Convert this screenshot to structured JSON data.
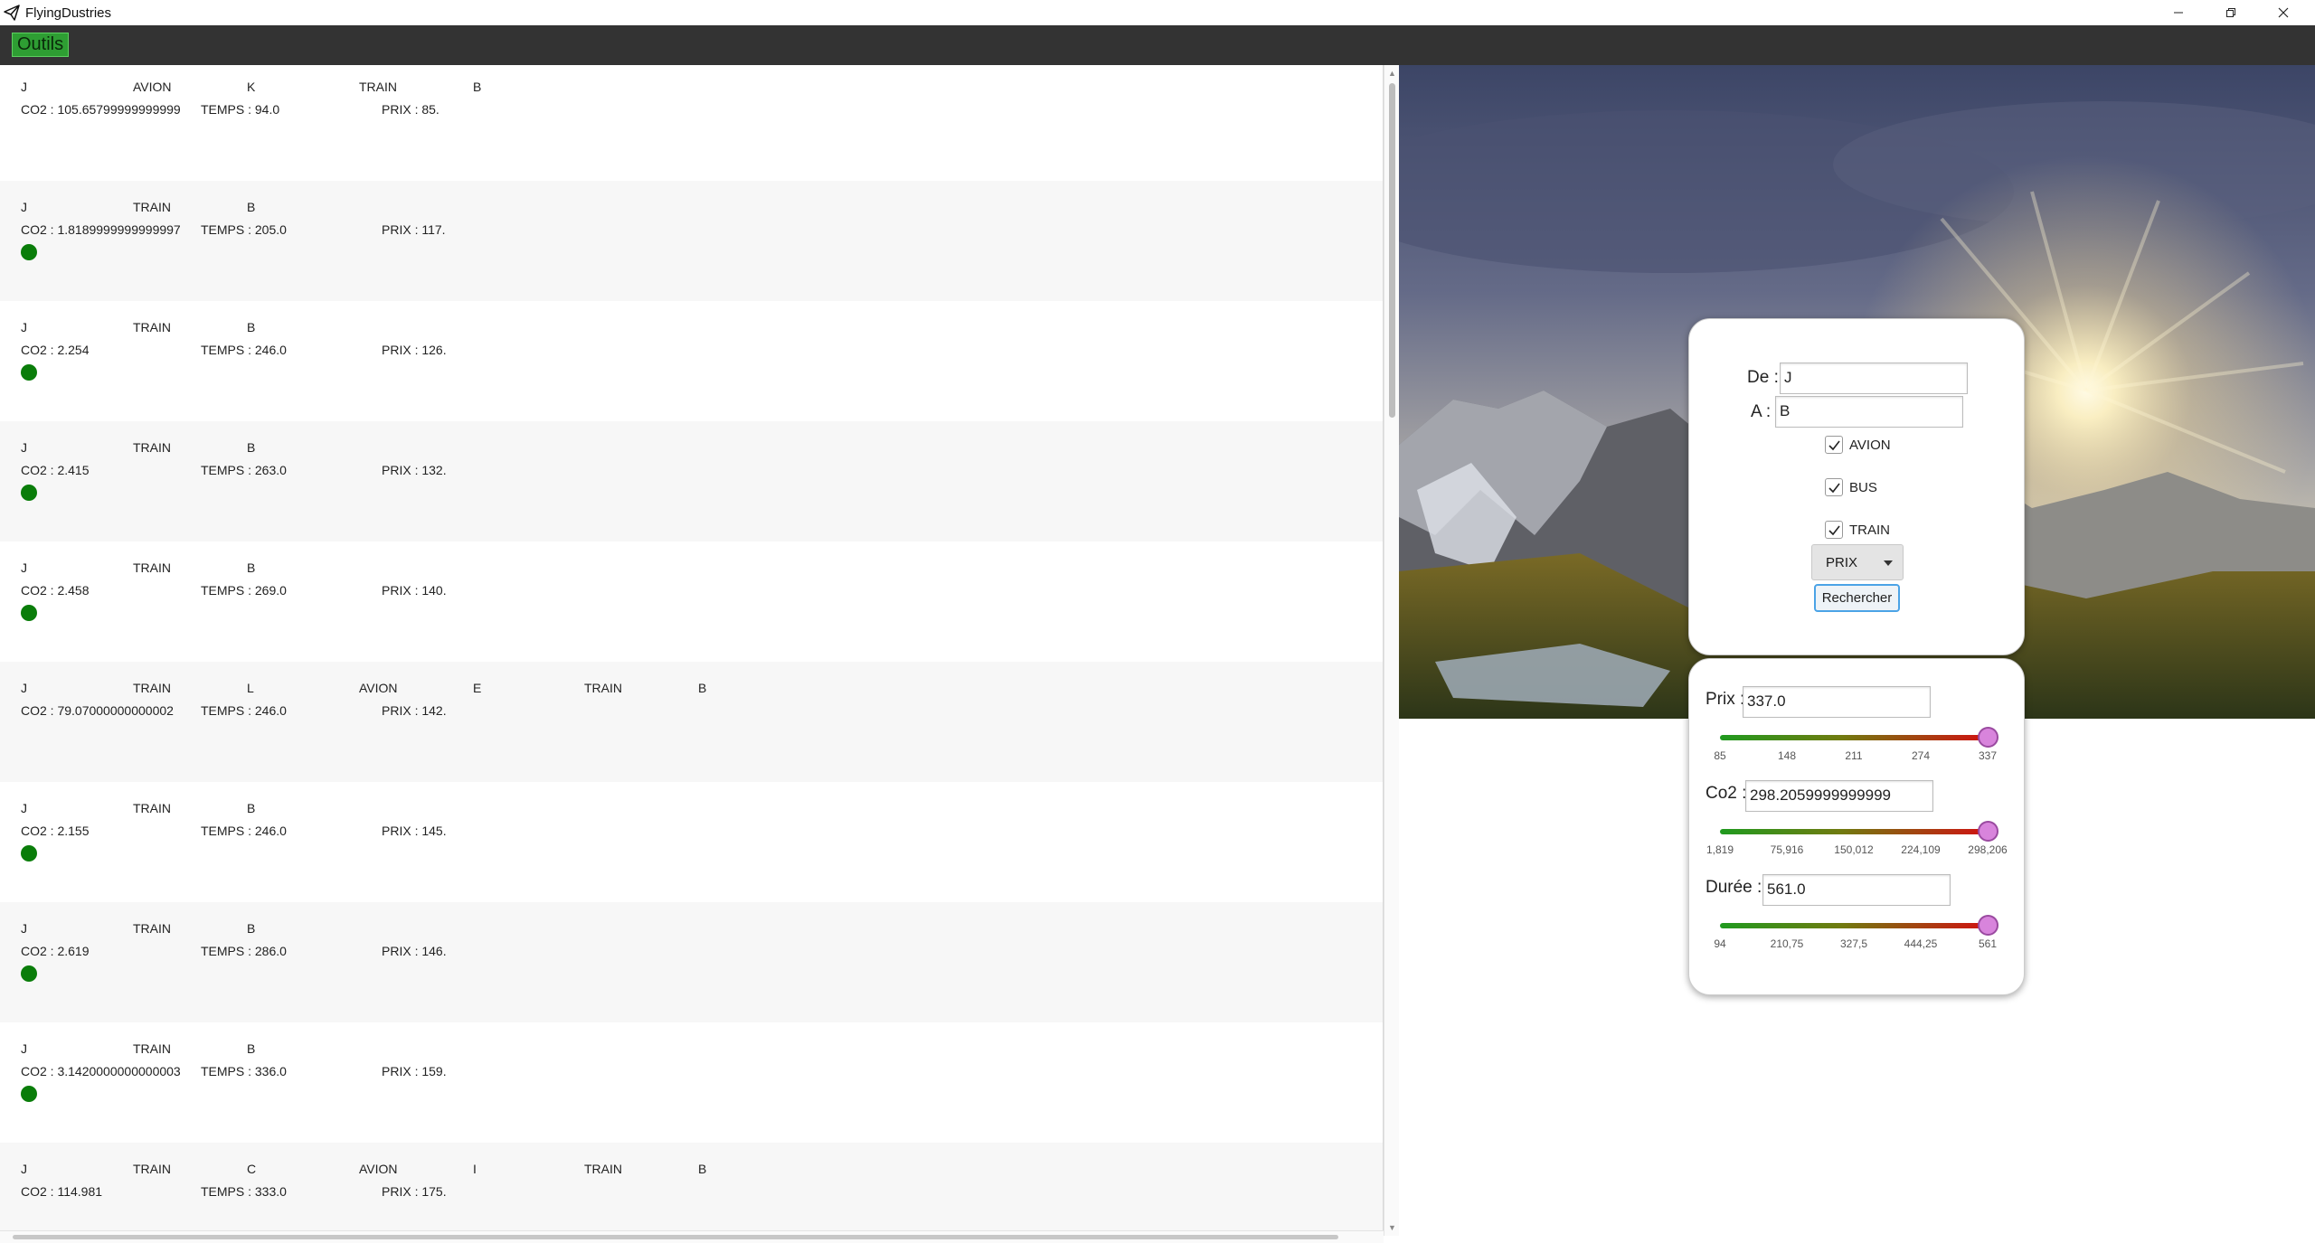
{
  "window": {
    "title": "FlyingDustries"
  },
  "menu": {
    "outils_label": "Outils"
  },
  "results": [
    {
      "route": [
        "J",
        "AVION",
        "K",
        "TRAIN",
        "B"
      ],
      "co2": "CO2 : 105.65799999999999",
      "temps": "TEMPS : 94.0",
      "prix": "PRIX : 85.",
      "green": false
    },
    {
      "route": [
        "J",
        "TRAIN",
        "B"
      ],
      "co2": "CO2 : 1.8189999999999997",
      "temps": "TEMPS : 205.0",
      "prix": "PRIX : 117.",
      "green": true
    },
    {
      "route": [
        "J",
        "TRAIN",
        "B"
      ],
      "co2": "CO2 : 2.254",
      "temps": "TEMPS : 246.0",
      "prix": "PRIX : 126.",
      "green": true
    },
    {
      "route": [
        "J",
        "TRAIN",
        "B"
      ],
      "co2": "CO2 : 2.415",
      "temps": "TEMPS : 263.0",
      "prix": "PRIX : 132.",
      "green": true
    },
    {
      "route": [
        "J",
        "TRAIN",
        "B"
      ],
      "co2": "CO2 : 2.458",
      "temps": "TEMPS : 269.0",
      "prix": "PRIX : 140.",
      "green": true
    },
    {
      "route": [
        "J",
        "TRAIN",
        "L",
        "AVION",
        "E",
        "TRAIN",
        "B"
      ],
      "co2": "CO2 : 79.07000000000002",
      "temps": "TEMPS : 246.0",
      "prix": "PRIX : 142.",
      "green": false
    },
    {
      "route": [
        "J",
        "TRAIN",
        "B"
      ],
      "co2": "CO2 : 2.155",
      "temps": "TEMPS : 246.0",
      "prix": "PRIX : 145.",
      "green": true
    },
    {
      "route": [
        "J",
        "TRAIN",
        "B"
      ],
      "co2": "CO2 : 2.619",
      "temps": "TEMPS : 286.0",
      "prix": "PRIX : 146.",
      "green": true
    },
    {
      "route": [
        "J",
        "TRAIN",
        "B"
      ],
      "co2": "CO2 : 3.1420000000000003",
      "temps": "TEMPS : 336.0",
      "prix": "PRIX : 159.",
      "green": true
    },
    {
      "route": [
        "J",
        "TRAIN",
        "C",
        "AVION",
        "I",
        "TRAIN",
        "B"
      ],
      "co2": "CO2 : 114.981",
      "temps": "TEMPS : 333.0",
      "prix": "PRIX : 175.",
      "green": false
    }
  ],
  "search": {
    "de_label": "De :",
    "de_value": "J",
    "a_label": "A :",
    "a_value": "B",
    "avion_label": "AVION",
    "avion_checked": true,
    "bus_label": "BUS",
    "bus_checked": true,
    "train_label": "TRAIN",
    "train_checked": true,
    "sort_value": "PRIX",
    "search_label": "Rechercher"
  },
  "filters": {
    "prix": {
      "label": "Prix :",
      "value": "337.0",
      "level": 1.0,
      "ticks": [
        "85",
        "148",
        "211",
        "274",
        "337"
      ]
    },
    "co2": {
      "label": "Co2 :",
      "value": "298.2059999999999",
      "level": 1.0,
      "ticks": [
        "1,819",
        "75,916",
        "150,012",
        "224,109",
        "298,206"
      ]
    },
    "duree": {
      "label": "Durée :",
      "value": "561.0",
      "level": 1.0,
      "ticks": [
        "94",
        "210,75",
        "327,5",
        "444,25",
        "561"
      ]
    }
  },
  "colors": {
    "menu_bg": "#333333",
    "outils_bg": "#2e9e33",
    "green_dot": "#0a7d0a",
    "slider_thumb": "#d884dc",
    "button_border": "#4ba3e6"
  }
}
